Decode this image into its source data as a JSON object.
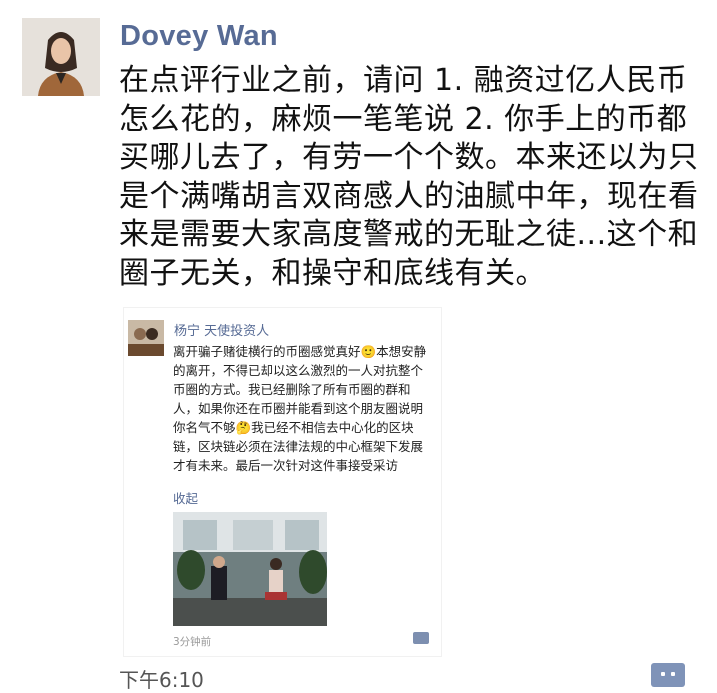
{
  "post": {
    "author": "Dovey Wan",
    "text": "在点评行业之前，请问 1. 融资过亿人民币怎么花的，麻烦一笔笔说 2. 你手上的币都买哪儿去了，有劳一个个数。本来还以为只是个满嘴胡言双商感人的油腻中年，现在看来是需要大家高度警戒的无耻之徒...这个和圈子无关，和操守和底线有关。",
    "time": "下午6:10",
    "avatar_icon": "avatar-photo",
    "more_icon": "more-dots-icon"
  },
  "screenshot": {
    "author": "杨宁 天使投资人",
    "text": "离开骗子赌徒横行的币圈感觉真好🙂本想安静的离开，不得已却以这么激烈的一人对抗整个币圈的方式。我已经删除了所有币圈的群和人，如果你还在币圈并能看到这个朋友圈说明你名气不够🤔我已经不相信去中心化的区块链，区块链必须在法律法规的中心框架下发展才有未来。最后一次针对这件事接受采访",
    "collapse_label": "收起",
    "time": "3分钟前",
    "video_icon": "video-thumbnail"
  },
  "colors": {
    "link": "#576b95",
    "text": "#111111",
    "meta": "#555555",
    "more_button": "#7f93b8"
  }
}
